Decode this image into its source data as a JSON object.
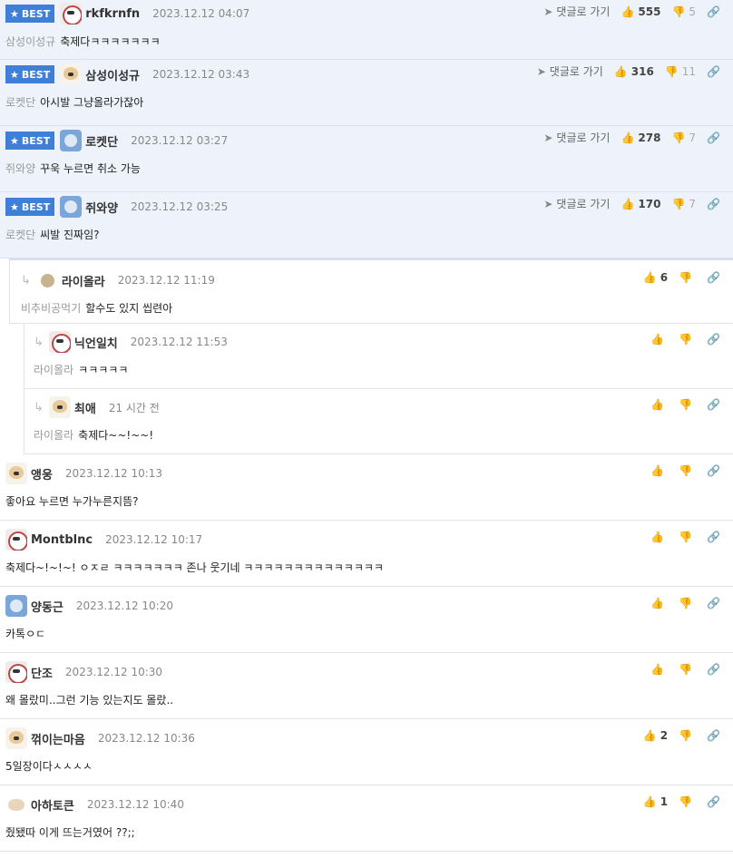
{
  "ui": {
    "best_label": "BEST",
    "goto_label": "댓글로 가기"
  },
  "icons": {
    "star": "★",
    "goto": "➤",
    "thumbs_up": "👍",
    "thumbs_down": "👎",
    "link": "🔗",
    "reply": "↳"
  },
  "comments": [
    {
      "type": "best",
      "avatar": "panda",
      "nick": "rkfkrnfn",
      "date": "2023.12.12 04:07",
      "mention": "삼성이성규",
      "text": "축제다ㅋㅋㅋㅋㅋㅋㅋ",
      "up": "555",
      "down": "5"
    },
    {
      "type": "best",
      "avatar": "dog",
      "nick": "삼성이성규",
      "date": "2023.12.12 03:43",
      "mention": "로켓단",
      "text": "아시발 그냥올라가잖아",
      "up": "316",
      "down": "11"
    },
    {
      "type": "best",
      "avatar": "blue",
      "nick": "로켓단",
      "date": "2023.12.12 03:27",
      "mention": "쥐와양",
      "text": "꾸욱 누르면 취소 가능",
      "up": "278",
      "down": "7"
    },
    {
      "type": "best",
      "avatar": "blue",
      "nick": "쥐와양",
      "date": "2023.12.12 03:25",
      "mention": "로켓단",
      "text": "씨발 진짜임?",
      "up": "170",
      "down": "7"
    },
    {
      "type": "reply",
      "avatar": "tan",
      "nick": "라이올라",
      "date": "2023.12.12 11:19",
      "mention": "비추비공먹기",
      "text": "할수도 있지 씹련아",
      "up": "6"
    },
    {
      "type": "reply2",
      "avatar": "panda",
      "nick": "닉언일치",
      "date": "2023.12.12 11:53",
      "mention": "라이올라",
      "text": "ㅋㅋㅋㅋㅋ"
    },
    {
      "type": "reply2",
      "avatar": "dog",
      "nick": "최애",
      "date": "21 시간 전",
      "mention": "라이올라",
      "text": "축제다~~!~~!"
    },
    {
      "type": "normal",
      "avatar": "dog",
      "nick": "앵웅",
      "date": "2023.12.12 10:13",
      "text": "좋아요 누르면 누가누른지뜸?"
    },
    {
      "type": "normal",
      "avatar": "panda",
      "nick": "Montblnc",
      "date": "2023.12.12 10:17",
      "text": "축제다~!~!~! ㅇㅈㄹ ㅋㅋㅋㅋㅋㅋㅋ 존나 웃기네 ㅋㅋㅋㅋㅋㅋㅋㅋㅋㅋㅋㅋㅋㅋ"
    },
    {
      "type": "normal",
      "avatar": "blue",
      "nick": "양동근",
      "date": "2023.12.12 10:20",
      "text": "카톡ㅇㄷ"
    },
    {
      "type": "normal",
      "avatar": "panda",
      "nick": "단조",
      "date": "2023.12.12 10:30",
      "text": "왜 몰랐미..그런 기능 있는지도 몰랐.."
    },
    {
      "type": "normal",
      "avatar": "dog",
      "nick": "꺾이는마음",
      "date": "2023.12.12 10:36",
      "text": "5일장이다ㅅㅅㅅㅅ",
      "up": "2"
    },
    {
      "type": "normal",
      "avatar": "pup",
      "nick": "아하토큰",
      "date": "2023.12.12 10:40",
      "text": "줬됐따 이게 뜨는거였어 ??;;",
      "up": "1"
    }
  ]
}
